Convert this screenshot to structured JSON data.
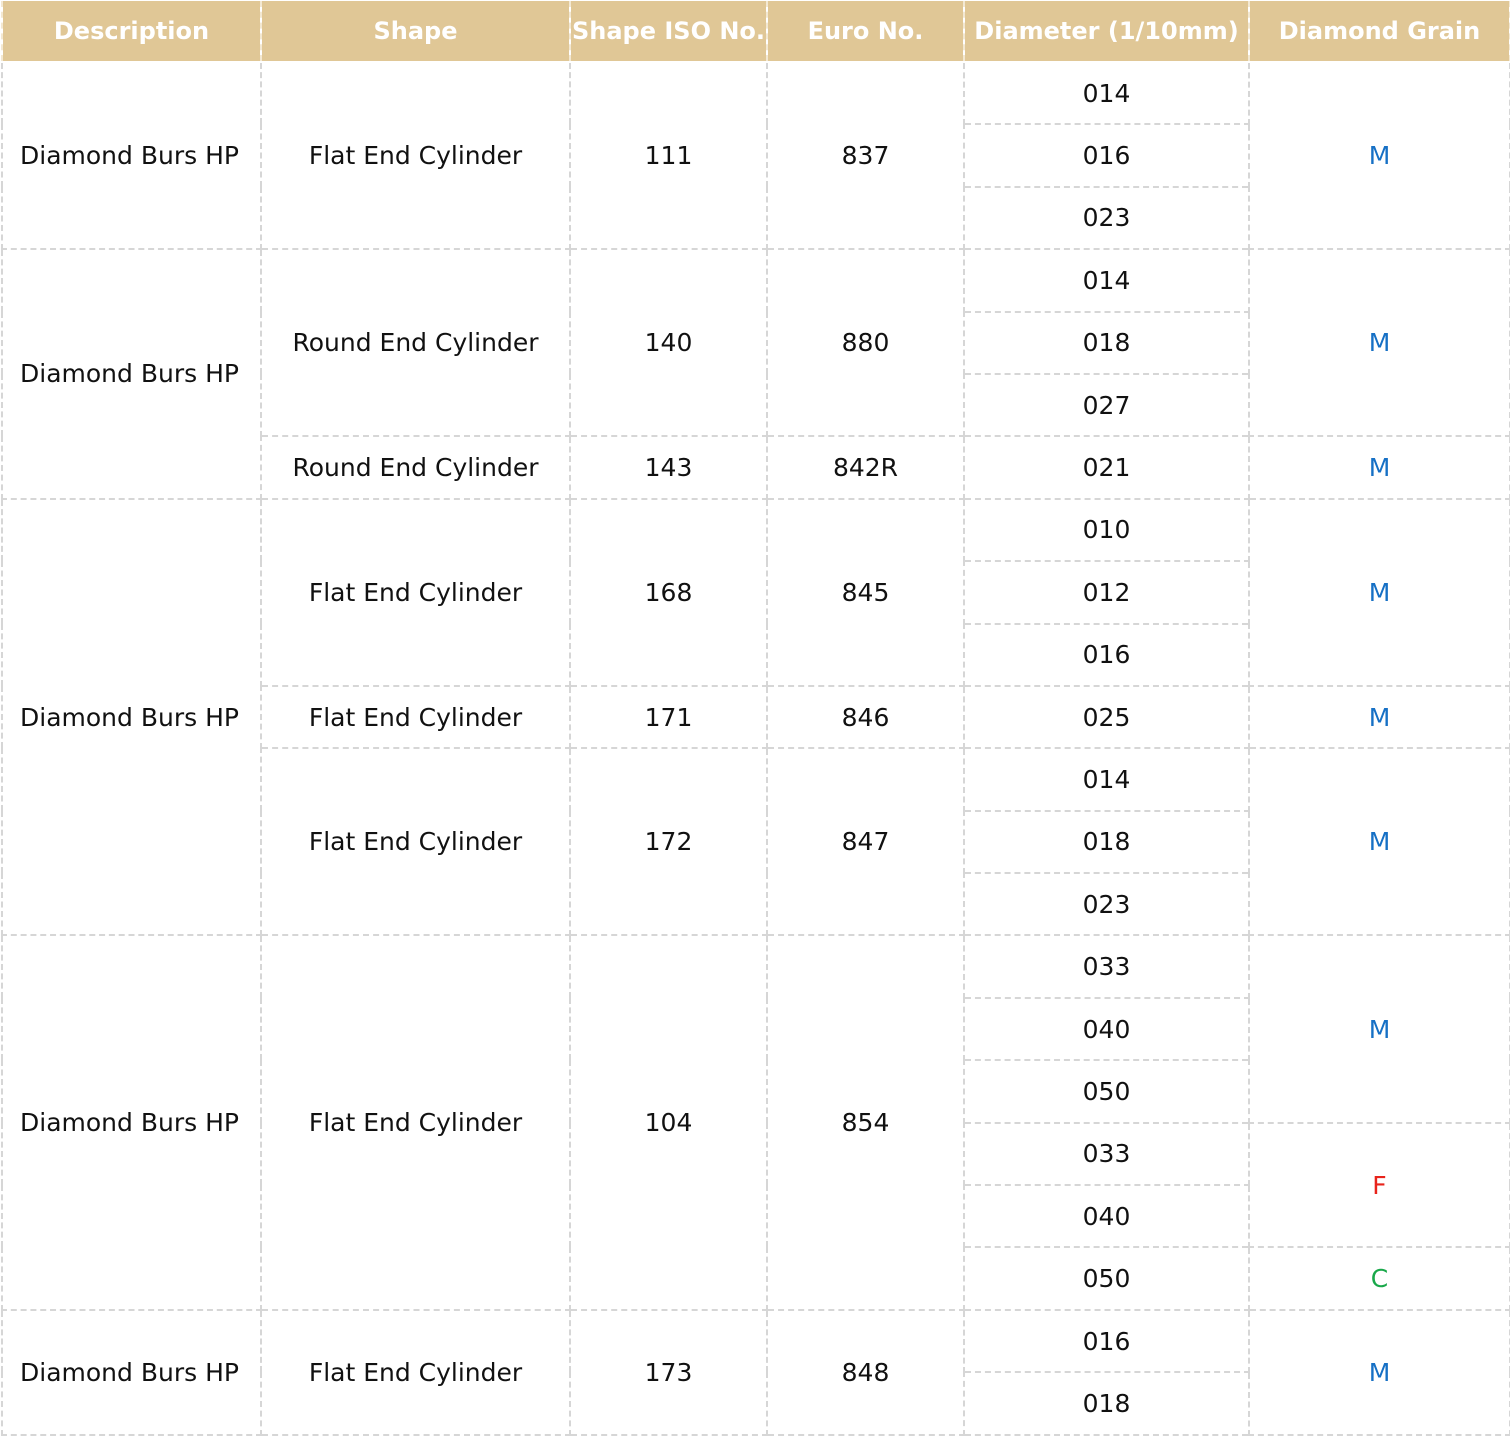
{
  "header": {
    "description": "Description",
    "shape": "Shape",
    "shape_iso_no": "Shape ISO No.",
    "euro_no": "Euro No.",
    "diameter": "Diameter (1/10mm)",
    "diamond_grain": "Diamond Grain"
  },
  "colors": {
    "header_bg": "#e0c796",
    "grain_M": "#1670c5",
    "grain_F": "#e8231b",
    "grain_C": "#19a84a"
  },
  "groups": [
    {
      "description": "Diamond Burs HP",
      "products": [
        {
          "shape": "Flat End Cylinder",
          "iso": "111",
          "euro": "837",
          "diameters": [
            "014",
            "016",
            "023"
          ],
          "grains": [
            {
              "value": "M",
              "diameters_count": 3
            }
          ]
        }
      ]
    },
    {
      "description": "Diamond Burs HP",
      "products": [
        {
          "shape": "Round End Cylinder",
          "iso": "140",
          "euro": "880",
          "diameters": [
            "014",
            "018",
            "027"
          ],
          "grains": [
            {
              "value": "M",
              "diameters_count": 3
            }
          ]
        },
        {
          "shape": "Round End Cylinder",
          "iso": "143",
          "euro": "842R",
          "diameters": [
            "021"
          ],
          "grains": [
            {
              "value": "M",
              "diameters_count": 1
            }
          ]
        }
      ]
    },
    {
      "description": "Diamond Burs HP",
      "products": [
        {
          "shape": "Flat End Cylinder",
          "iso": "168",
          "euro": "845",
          "diameters": [
            "010",
            "012",
            "016"
          ],
          "grains": [
            {
              "value": "M",
              "diameters_count": 3
            }
          ]
        },
        {
          "shape": "Flat End Cylinder",
          "iso": "171",
          "euro": "846",
          "diameters": [
            "025"
          ],
          "grains": [
            {
              "value": "M",
              "diameters_count": 1
            }
          ]
        },
        {
          "shape": "Flat End Cylinder",
          "iso": "172",
          "euro": "847",
          "diameters": [
            "014",
            "018",
            "023"
          ],
          "grains": [
            {
              "value": "M",
              "diameters_count": 3
            }
          ]
        }
      ]
    },
    {
      "description": "Diamond Burs HP",
      "products": [
        {
          "shape": "Flat End Cylinder",
          "iso": "104",
          "euro": "854",
          "diameters": [
            "033",
            "040",
            "050",
            "033",
            "040",
            "050"
          ],
          "grains": [
            {
              "value": "M",
              "diameters_count": 3
            },
            {
              "value": "F",
              "diameters_count": 2
            },
            {
              "value": "C",
              "diameters_count": 1
            }
          ]
        }
      ]
    },
    {
      "description": "Diamond Burs HP",
      "products": [
        {
          "shape": "Flat End Cylinder",
          "iso": "173",
          "euro": "848",
          "diameters": [
            "016",
            "018"
          ],
          "grains": [
            {
              "value": "M",
              "diameters_count": 2
            }
          ]
        }
      ]
    }
  ]
}
